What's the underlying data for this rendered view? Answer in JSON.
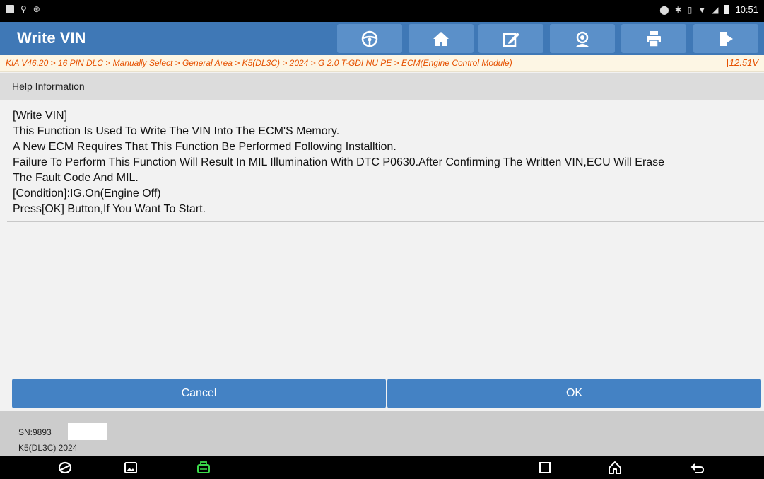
{
  "status_bar": {
    "time": "10:51",
    "icons": [
      "image-icon",
      "usb-icon",
      "bluetooth-icon",
      "location-icon",
      "bluetooth-icon",
      "vibrate-icon",
      "wifi-icon",
      "signal-icon",
      "battery-icon"
    ]
  },
  "header": {
    "title": "Write VIN",
    "toolbar": [
      "steering-wheel-icon",
      "home-icon",
      "edit-icon",
      "support-icon",
      "print-icon",
      "exit-icon"
    ]
  },
  "breadcrumb": {
    "path": "KIA V46.20 > 16 PIN DLC > Manually Select > General Area > K5(DL3C) > 2024 > G 2.0 T-GDI NU PE > ECM(Engine Control Module)",
    "voltage": "12.51V"
  },
  "help": {
    "header": "Help Information",
    "lines": [
      "[Write VIN]",
      "This Function Is Used To Write The VIN Into The ECM'S Memory.",
      "A New ECM Requires That This Function Be Performed Following Installtion.",
      "Failure To Perform This Function Will Result In MIL Illumination With DTC P0630.After Confirming The Written VIN,ECU Will Erase",
      "The Fault Code And MIL.",
      "[Condition]:IG.On(Engine Off)",
      "Press[OK] Button,If You Want To Start."
    ]
  },
  "buttons": {
    "cancel": "Cancel",
    "ok": "OK"
  },
  "footer": {
    "sn": "SN:9893",
    "vehicle": "K5(DL3C) 2024"
  },
  "nav_bar": {
    "icons": [
      "browser-icon",
      "gallery-icon",
      "vci-icon",
      "recents-icon",
      "home-icon",
      "back-icon"
    ]
  },
  "colors": {
    "title_bar": "#3f78b6",
    "button": "#4482c4",
    "breadcrumb_text": "#e65100",
    "breadcrumb_bg": "#fdf6e4"
  }
}
